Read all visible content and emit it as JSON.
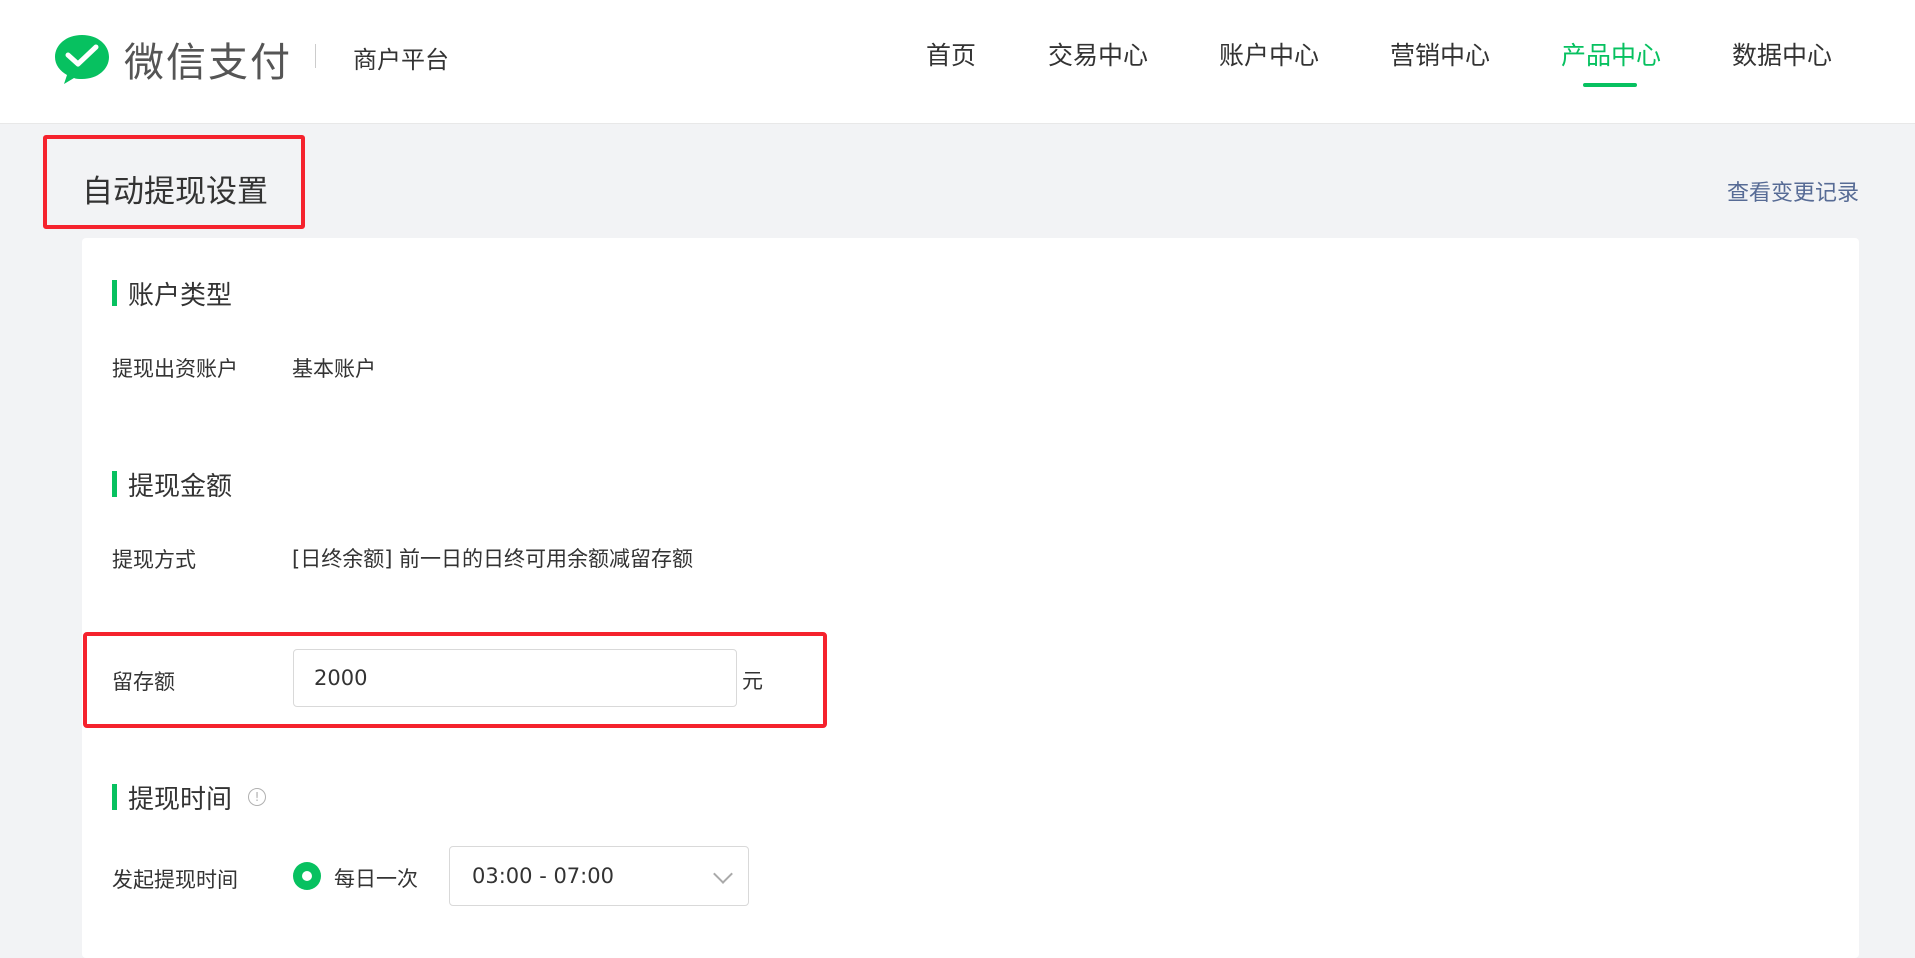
{
  "brand": {
    "name": "微信支付",
    "platform": "商户平台"
  },
  "nav": {
    "items": [
      {
        "label": "首页"
      },
      {
        "label": "交易中心"
      },
      {
        "label": "账户中心"
      },
      {
        "label": "营销中心"
      },
      {
        "label": "产品中心"
      },
      {
        "label": "数据中心"
      }
    ],
    "active": "产品中心"
  },
  "page": {
    "title": "自动提现设置",
    "change_log": "查看变更记录"
  },
  "account_section": {
    "title": "账户类型",
    "label": "提现出资账户",
    "value": "基本账户"
  },
  "amount_section": {
    "title": "提现金额",
    "method_label": "提现方式",
    "method_value": "[日终余额] 前一日的日终可用余额减留存额",
    "retain_label": "留存额",
    "retain_value": "2000",
    "unit": "元"
  },
  "time_section": {
    "title": "提现时间",
    "start_label": "发起提现时间",
    "frequency": "每日一次",
    "range": "03:00 - 07:00"
  },
  "colors": {
    "accent": "#07c160",
    "highlight": "#f5222d",
    "link": "#576b95"
  }
}
